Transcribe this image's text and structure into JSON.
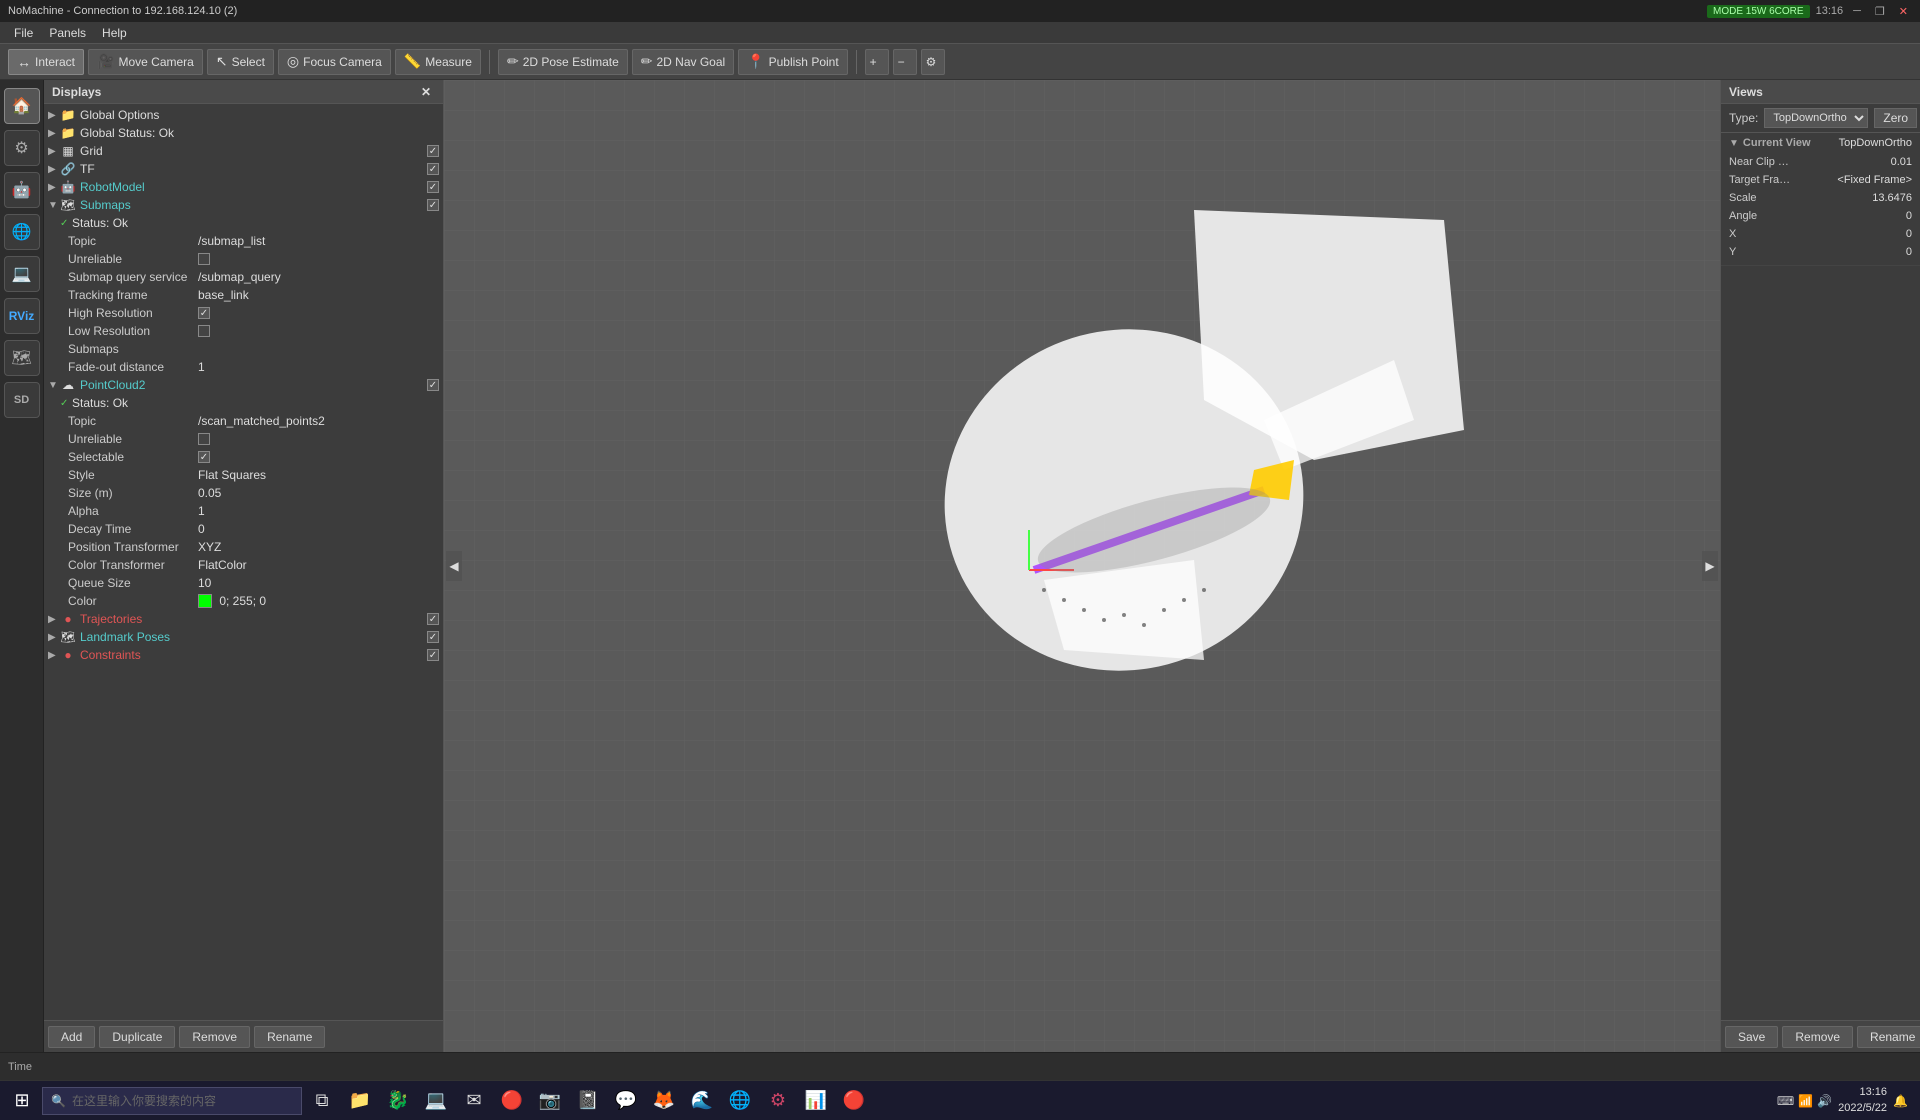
{
  "nm_bar": {
    "title": "NoMachine - Connection to 192.168.124.10 (2)",
    "mode_badge": "MODE 15W 6CORE",
    "time": "13:16",
    "controls": [
      "minimize",
      "restore",
      "close"
    ]
  },
  "menubar": {
    "items": [
      "File",
      "Panels",
      "Help"
    ]
  },
  "toolbar": {
    "interact_label": "Interact",
    "move_camera_label": "Move Camera",
    "select_label": "Select",
    "focus_camera_label": "Focus Camera",
    "measure_label": "Measure",
    "pose_estimate_label": "2D Pose Estimate",
    "nav_goal_label": "2D Nav Goal",
    "publish_point_label": "Publish Point"
  },
  "displays_panel": {
    "title": "Displays",
    "items": [
      {
        "label": "Global Options",
        "type": "folder",
        "indent": 0,
        "color": "normal"
      },
      {
        "label": "Global Status: Ok",
        "type": "folder",
        "indent": 0,
        "color": "normal"
      },
      {
        "label": "Grid",
        "type": "item",
        "indent": 0,
        "color": "normal",
        "checked": true
      },
      {
        "label": "TF",
        "type": "item",
        "indent": 0,
        "color": "normal",
        "checked": true
      },
      {
        "label": "RobotModel",
        "type": "item",
        "indent": 0,
        "color": "cyan",
        "checked": true
      },
      {
        "label": "Submaps",
        "type": "folder",
        "indent": 0,
        "color": "cyan",
        "checked": true
      }
    ],
    "submaps_children": [
      {
        "label": "Status: Ok",
        "indent": 1
      },
      {
        "label": "Topic",
        "value": "/submap_list",
        "indent": 1
      },
      {
        "label": "Unreliable",
        "value": "",
        "indent": 1,
        "is_checkbox": true,
        "checked": false
      },
      {
        "label": "Submap query service",
        "value": "/submap_query",
        "indent": 1
      },
      {
        "label": "Tracking frame",
        "value": "base_link",
        "indent": 1
      },
      {
        "label": "High Resolution",
        "value": "",
        "indent": 1,
        "is_checkbox": true,
        "checked": true
      },
      {
        "label": "Low Resolution",
        "value": "",
        "indent": 1,
        "is_checkbox": true,
        "checked": false
      },
      {
        "label": "Submaps",
        "value": "",
        "indent": 1
      },
      {
        "label": "Fade-out distance",
        "value": "1",
        "indent": 1
      }
    ],
    "pointcloud2": {
      "label": "PointCloud2",
      "color": "cyan",
      "checked": true,
      "children": [
        {
          "label": "Status: Ok",
          "indent": 1
        },
        {
          "label": "Topic",
          "value": "/scan_matched_points2",
          "indent": 1
        },
        {
          "label": "Unreliable",
          "value": "",
          "indent": 1,
          "is_checkbox": true,
          "checked": false
        },
        {
          "label": "Selectable",
          "value": "",
          "indent": 1,
          "is_checkbox": true,
          "checked": true
        },
        {
          "label": "Style",
          "value": "Flat Squares",
          "indent": 1
        },
        {
          "label": "Size (m)",
          "value": "0.05",
          "indent": 1
        },
        {
          "label": "Alpha",
          "value": "1",
          "indent": 1
        },
        {
          "label": "Decay Time",
          "value": "0",
          "indent": 1
        },
        {
          "label": "Position Transformer",
          "value": "XYZ",
          "indent": 1
        },
        {
          "label": "Color Transformer",
          "value": "FlatColor",
          "indent": 1
        },
        {
          "label": "Queue Size",
          "value": "10",
          "indent": 1
        },
        {
          "label": "Color",
          "value": "0; 255; 0",
          "indent": 1,
          "has_swatch": true,
          "swatch_color": "#00ff00"
        }
      ]
    },
    "other_items": [
      {
        "label": "Trajectories",
        "color": "red",
        "checked": true
      },
      {
        "label": "Landmark Poses",
        "color": "cyan",
        "checked": true
      },
      {
        "label": "Constraints",
        "color": "red",
        "checked": true
      }
    ],
    "footer_buttons": [
      "Add",
      "Duplicate",
      "Remove",
      "Rename"
    ]
  },
  "views_panel": {
    "title": "Views",
    "type_label": "Type:",
    "type_value": "TopDownOrtho",
    "zero_btn": "Zero",
    "current_view": {
      "label": "Current View",
      "type": "TopDownOrtho",
      "near_clip": "0.01",
      "target_frame": "<Fixed Frame>",
      "scale": "13.6476",
      "angle": "0",
      "x": "0",
      "y": "0"
    },
    "footer_buttons": [
      "Save",
      "Remove",
      "Rename"
    ]
  },
  "statusbar": {
    "time_label": "Time"
  },
  "taskbar": {
    "search_placeholder": "在这里输入你要搜索的内容",
    "time": "13:16",
    "date": "2022/5/22"
  }
}
